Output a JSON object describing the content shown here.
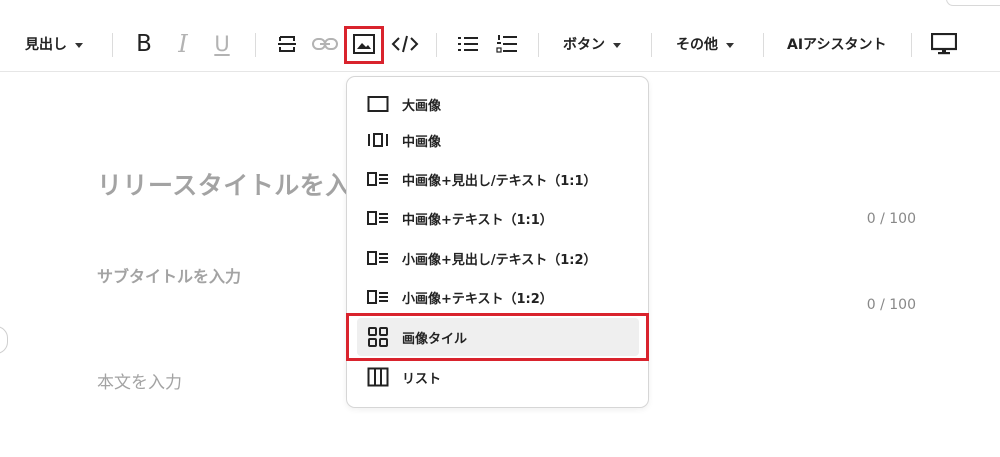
{
  "toolbar": {
    "heading_label": "見出し",
    "bold_label": "B",
    "italic_label": "I",
    "underline_label": "U",
    "button_label": "ボタン",
    "other_label": "その他",
    "ai_label": "AIアシスタント",
    "icons": [
      "strikethrough-icon",
      "link-icon",
      "image-icon",
      "code-icon",
      "bullet-list-icon",
      "numbered-list-icon",
      "monitor-icon"
    ]
  },
  "editor": {
    "title_placeholder": "リリースタイトルを入力",
    "title_count": "0 / 100",
    "subtitle_placeholder": "サブタイトルを入力",
    "subtitle_count": "0 / 100",
    "body_placeholder": "本文を入力"
  },
  "image_menu": {
    "items": [
      {
        "label": "大画像",
        "icon": "large-image-icon"
      },
      {
        "label": "中画像",
        "icon": "medium-image-icon"
      },
      {
        "label": "中画像+見出し/テキスト（1:1）",
        "icon": "image-text-icon"
      },
      {
        "label": "中画像+テキスト（1:1）",
        "icon": "image-text-icon"
      },
      {
        "label": "小画像+見出し/テキスト（1:2）",
        "icon": "image-text-icon"
      },
      {
        "label": "小画像+テキスト（1:2）",
        "icon": "image-text-icon"
      },
      {
        "label": "画像タイル",
        "icon": "image-tile-icon"
      },
      {
        "label": "リスト",
        "icon": "list-columns-icon"
      }
    ],
    "selected": "画像タイル"
  },
  "colors": {
    "highlight": "#d9232d",
    "placeholder": "#a3a3a3",
    "menu_hover": "#efefef"
  }
}
